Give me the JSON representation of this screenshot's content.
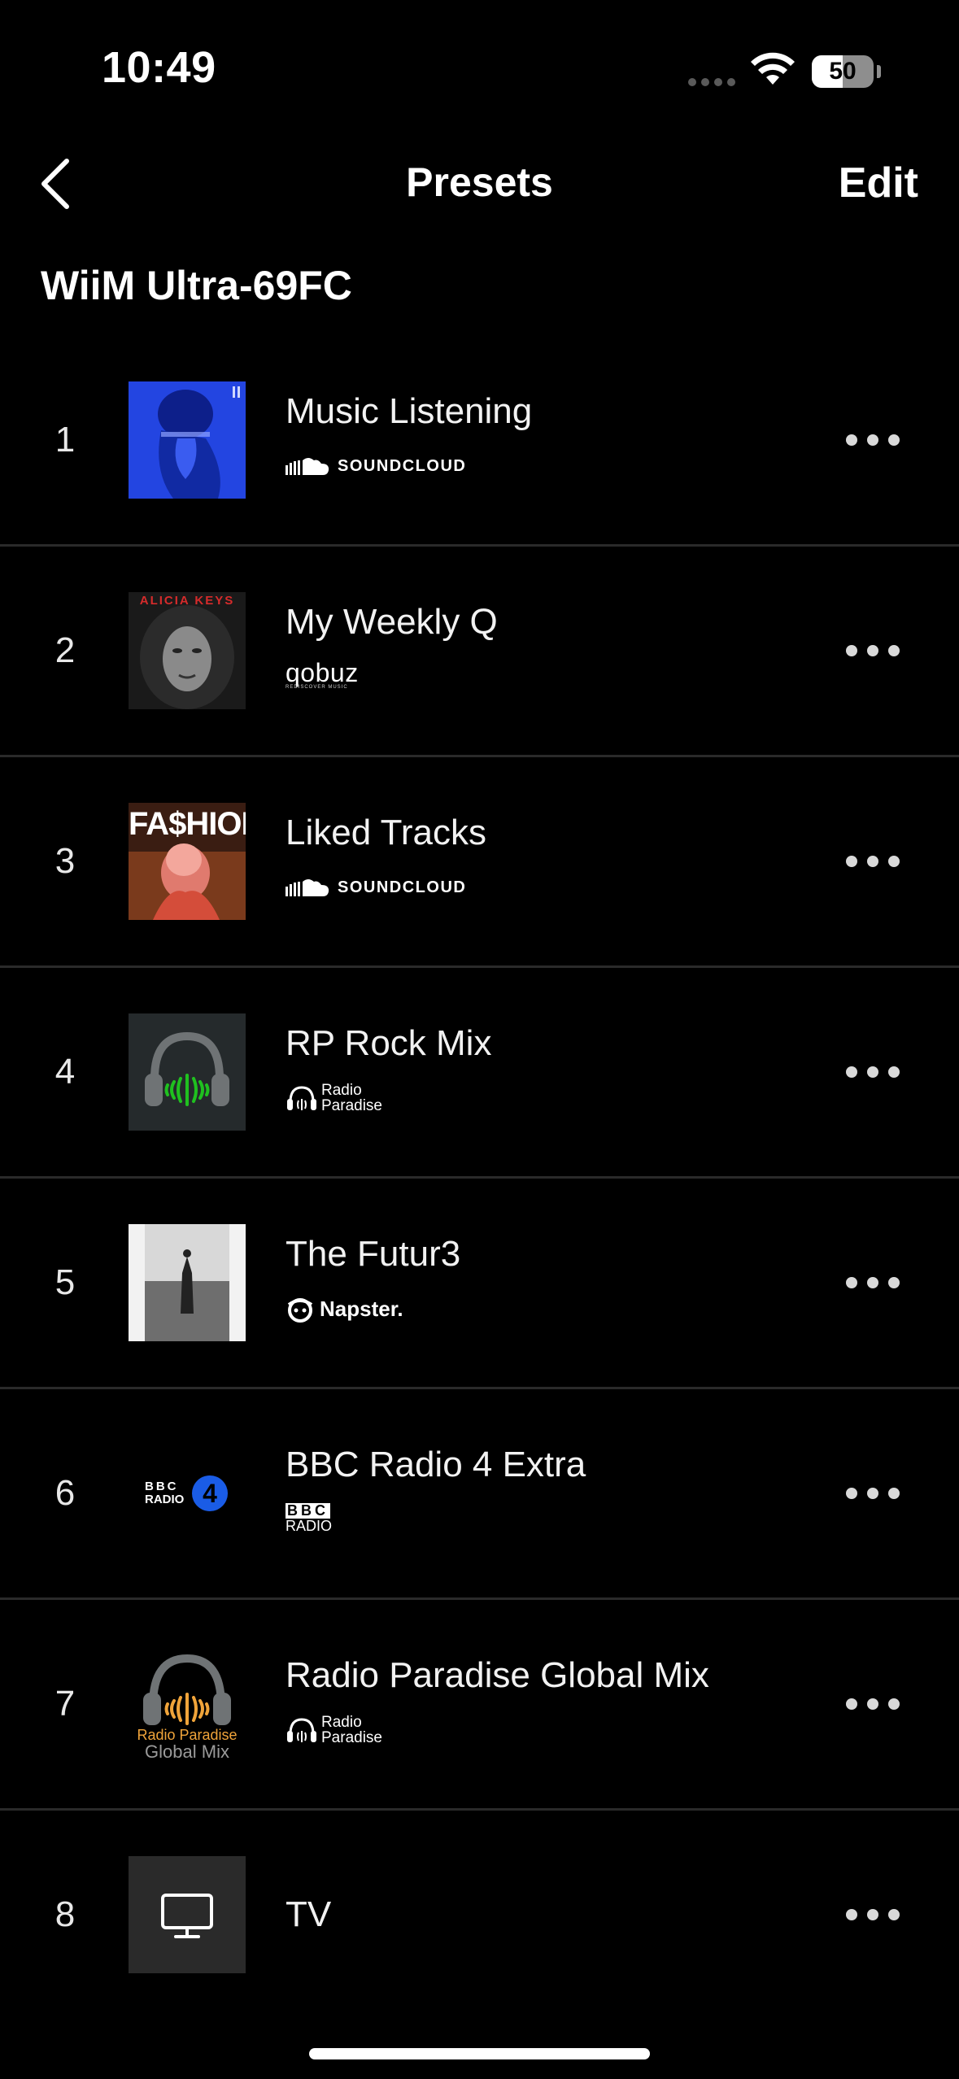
{
  "status_bar": {
    "time": "10:49",
    "battery": "50"
  },
  "nav": {
    "title": "Presets",
    "edit_label": "Edit"
  },
  "device": {
    "name": "WiiM Ultra-69FC"
  },
  "presets": [
    {
      "number": "1",
      "title": "Music Listening",
      "source": "SOUNDCLOUD",
      "art_icon": "album-art-blue-portrait"
    },
    {
      "number": "2",
      "title": "My Weekly Q",
      "source": "qobuz",
      "source_tagline": "REDISCOVER MUSIC",
      "art_icon": "album-art-alicia-keys",
      "art_text": "ALICIA KEYS"
    },
    {
      "number": "3",
      "title": "Liked Tracks",
      "source": "SOUNDCLOUD",
      "art_icon": "album-art-fashion",
      "art_text": "FA$HION"
    },
    {
      "number": "4",
      "title": "RP Rock Mix",
      "source_line1": "Radio",
      "source_line2": "Paradise",
      "art_icon": "headphones-green-icon"
    },
    {
      "number": "5",
      "title": "The Futur3",
      "source": "Napster.",
      "art_icon": "album-art-futur3"
    },
    {
      "number": "6",
      "title": "BBC Radio 4 Extra",
      "source_line1": "BBC",
      "source_line2": "RADIO",
      "art_icon": "bbc-radio-4-extra-logo",
      "art_text_1": "BBC",
      "art_text_2": "RADIO",
      "art_badge": "4"
    },
    {
      "number": "7",
      "title": "Radio Paradise Global Mix",
      "source_line1": "Radio",
      "source_line2": "Paradise",
      "art_icon": "headphones-orange-icon",
      "art_text_1": "Radio Paradise",
      "art_text_2": "Global Mix"
    },
    {
      "number": "8",
      "title": "TV",
      "art_icon": "tv-monitor-icon"
    }
  ],
  "colors": {
    "background": "#000000",
    "divider": "#2a2a2a",
    "accent_green": "#1fc11f",
    "accent_orange": "#f0a43a",
    "bbc_blue": "#1a5ce6"
  }
}
